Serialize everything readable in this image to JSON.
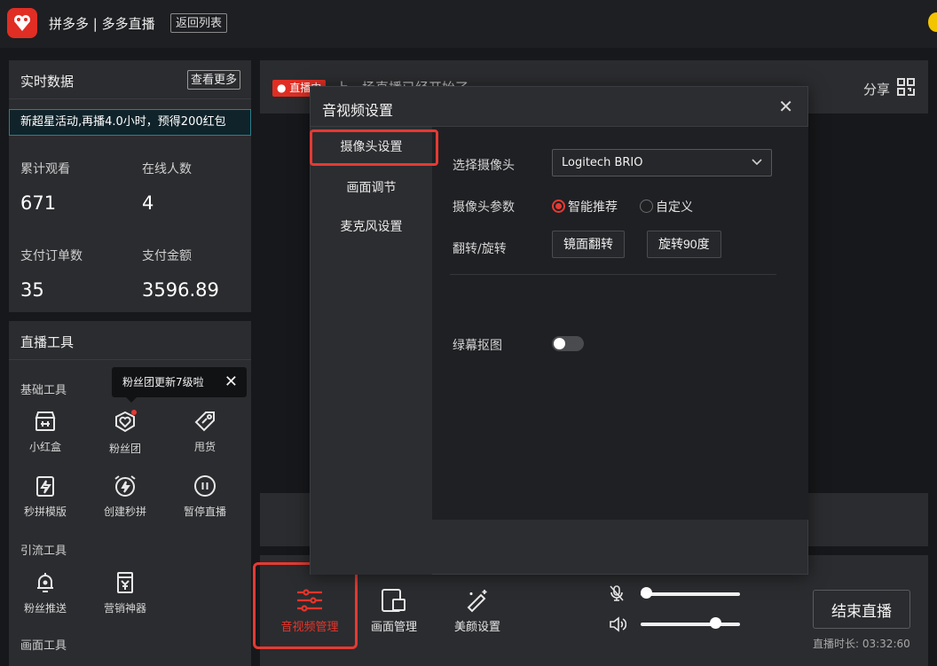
{
  "app": {
    "title": "拼多多 | 多多直播",
    "back_label": "返回列表",
    "logo_text": "拼多多"
  },
  "data_panel": {
    "title": "实时数据",
    "more_label": "查看更多",
    "banner": "新超星活动,再播4.0小时，预得200红包",
    "stats": [
      {
        "label": "累计观看",
        "value": "671"
      },
      {
        "label": "在线人数",
        "value": "4"
      },
      {
        "label": "支付订单数",
        "value": "35"
      },
      {
        "label": "支付金额",
        "value": "3596.89"
      }
    ]
  },
  "tools_panel": {
    "title": "直播工具",
    "basic_label": "基础工具",
    "traffic_label": "引流工具",
    "screen_label": "画面工具",
    "tooltip": "粉丝团更新7级啦",
    "tools": [
      {
        "label": "小红盒",
        "icon": "red-box-icon"
      },
      {
        "label": "粉丝团",
        "icon": "fan-club-icon"
      },
      {
        "label": "甩货",
        "icon": "tag-icon"
      },
      {
        "label": "秒拼模版",
        "icon": "flash-icon"
      },
      {
        "label": "创建秒拼",
        "icon": "alarm-flash-icon"
      },
      {
        "label": "暂停直播",
        "icon": "pause-icon"
      },
      {
        "label": "粉丝推送",
        "icon": "bell-icon"
      },
      {
        "label": "营销神器",
        "icon": "coupon-icon"
      }
    ]
  },
  "main": {
    "live_badge": "● 直播中",
    "title_hidden": "上一场直播已经开始了",
    "share_label": "分享"
  },
  "bottom_bar": {
    "buttons": [
      {
        "label": "音视频管理",
        "icon": "sliders-icon",
        "active": true
      },
      {
        "label": "画面管理",
        "icon": "screen-layout-icon",
        "active": false
      },
      {
        "label": "美颜设置",
        "icon": "magic-wand-icon",
        "active": false
      }
    ],
    "mic_level": 0.05,
    "speaker_level": 0.75,
    "end_label": "结束直播",
    "duration": "直播时长: 03:32:60"
  },
  "modal": {
    "title": "音视频设置",
    "nav": [
      {
        "label": "摄像头设置",
        "active": true
      },
      {
        "label": "画面调节",
        "active": false
      },
      {
        "label": "麦克风设置",
        "active": false
      }
    ],
    "select_camera_label": "选择摄像头",
    "camera_value": "Logitech BRIO",
    "camera_params_label": "摄像头参数",
    "radio_smart": "智能推荐",
    "radio_custom": "自定义",
    "flip_label": "翻转/旋转",
    "mirror_btn": "镜面翻转",
    "rotate_btn": "旋转90度",
    "greenscreen_label": "绿幕抠图",
    "greenscreen_on": false
  },
  "colors": {
    "accent": "#e53a33",
    "brand": "#e02e24",
    "panel_bg": "#2b2c2f",
    "page_bg": "#17181b"
  }
}
